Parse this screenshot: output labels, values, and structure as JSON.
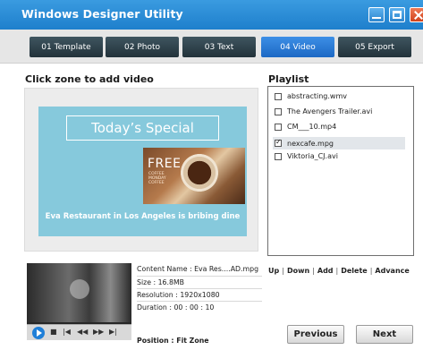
{
  "window": {
    "title": "Windows Designer Utility"
  },
  "tabs": [
    {
      "label": "01 Template",
      "active": false
    },
    {
      "label": "02 Photo",
      "active": false
    },
    {
      "label": "03 Text",
      "active": false
    },
    {
      "label": "04 Video",
      "active": true
    },
    {
      "label": "05 Export",
      "active": false
    }
  ],
  "zone": {
    "title": "Click zone to add video",
    "special": "Today’s Special",
    "free": "FREE",
    "free_sub": "COFFEE\nMONDAY\nCOFFEE",
    "caption": "Eva Restaurant in Los Angeles is bribing dine"
  },
  "playlist": {
    "title": "Playlist",
    "items": [
      {
        "label": "abstracting.wmv",
        "checked": false
      },
      {
        "label": "The Avengers Trailer.avi",
        "checked": false
      },
      {
        "label": "CM___10.mp4",
        "checked": false
      },
      {
        "label": "nexcafe.mpg",
        "checked": true
      },
      {
        "label": "Viktoria_CJ.avi",
        "checked": false
      }
    ],
    "actions": [
      "Up",
      "Down",
      "Add",
      "Delete",
      "Advance"
    ]
  },
  "content_info": {
    "name": "Content Name : Eva Res....AD.mpg",
    "size": "Size : 16.8MB",
    "resolution": "Resolution : 1920x1080",
    "duration": "Duration : 00 : 00 : 10",
    "position": "Position : Fit Zone"
  },
  "player_controls": [
    "|◀",
    "◀◀",
    "▶▶",
    "▶|"
  ],
  "buttons": {
    "previous": "Previous",
    "next": "Next"
  },
  "colors": {
    "titlebar": "#1e7fcc",
    "active_tab": "#1c68c4",
    "tab": "#22323a",
    "poster": "#86c9dc"
  }
}
